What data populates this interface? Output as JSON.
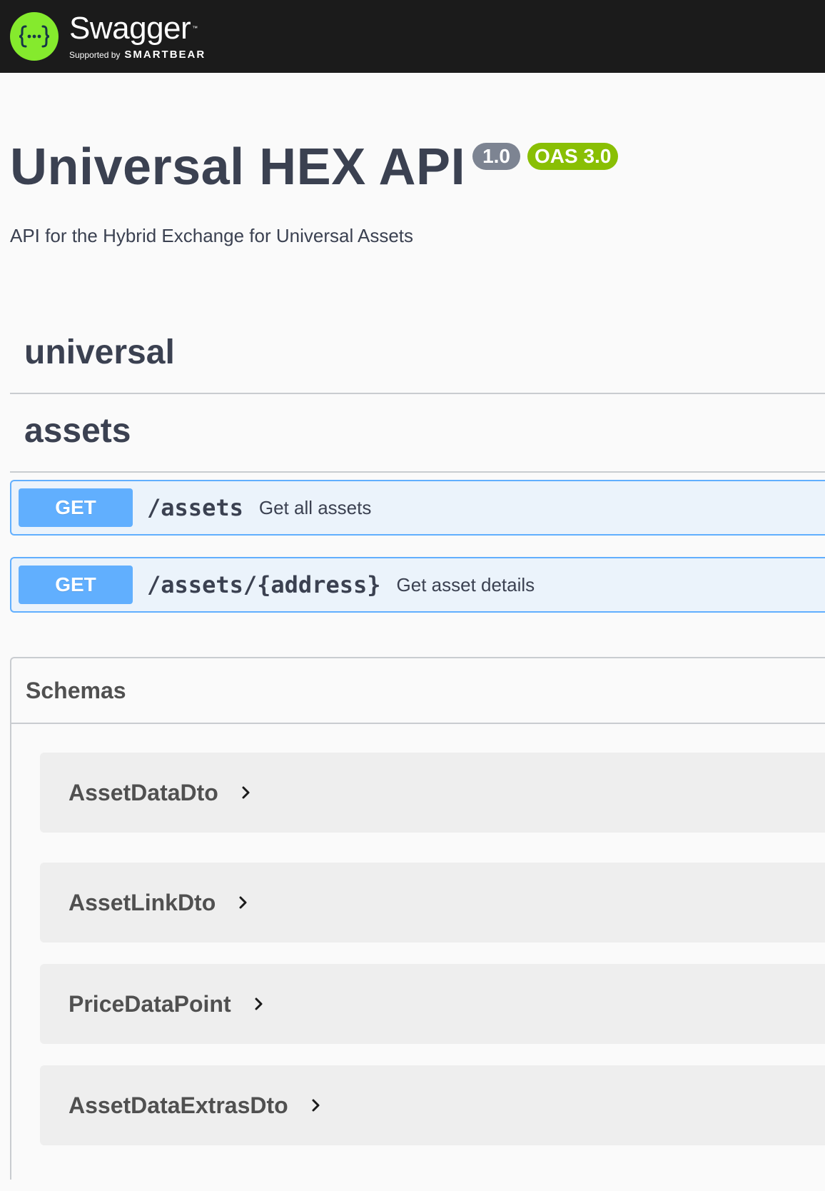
{
  "topbar": {
    "logo_icon": "swagger-braces-icon",
    "logo_name": "Swagger",
    "logo_tm": "™",
    "supported_by": "Supported by",
    "brand": "SMARTBEAR",
    "colors": {
      "background": "#1b1b1b",
      "logo_green": "#85ea2d"
    }
  },
  "info": {
    "title": "Universal HEX API",
    "version": "1.0",
    "oas": "OAS 3.0",
    "description": "API for the Hybrid Exchange for Universal Assets",
    "colors": {
      "version_badge": "#7d8492",
      "oas_badge": "#89bf04"
    }
  },
  "tags": [
    {
      "name": "universal",
      "operations": []
    },
    {
      "name": "assets",
      "operations": [
        {
          "method": "GET",
          "path": "/assets",
          "summary": "Get all assets"
        },
        {
          "method": "GET",
          "path": "/assets/{address}",
          "summary": "Get asset details"
        }
      ]
    }
  ],
  "method_colors": {
    "GET": "#61affe",
    "GET_bg": "#ebf3fb"
  },
  "schemas": {
    "title": "Schemas",
    "models": [
      {
        "name": "AssetDataDto",
        "icon": "chevron-right-icon"
      },
      {
        "name": "AssetLinkDto",
        "icon": "chevron-right-icon"
      },
      {
        "name": "PriceDataPoint",
        "icon": "chevron-right-icon"
      },
      {
        "name": "AssetDataExtrasDto",
        "icon": "chevron-right-icon"
      }
    ]
  }
}
